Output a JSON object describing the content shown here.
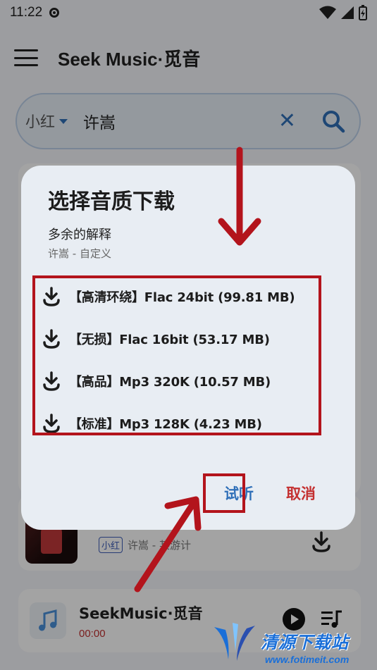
{
  "status_bar": {
    "time": "11:22"
  },
  "app_bar": {
    "title": "Seek Music·觅音"
  },
  "search": {
    "source": "小红",
    "query": "许嵩"
  },
  "background_result": {
    "tag": "小红",
    "meta": "许嵩 - 某游计"
  },
  "player": {
    "title": "SeekMusic·觅音",
    "time": "00:00"
  },
  "dialog": {
    "title": "选择音质下载",
    "song_title": "多余的解释",
    "song_subtitle": "许嵩 - 自定义",
    "qualities": [
      {
        "label": "【高清环绕】Flac 24bit (99.81 MB)"
      },
      {
        "label": "【无损】Flac 16bit (53.17 MB)"
      },
      {
        "label": "【高品】Mp3 320K (10.57 MB)"
      },
      {
        "label": "【标准】Mp3 128K (4.23 MB)"
      }
    ],
    "listen_button": "试听",
    "cancel_button": "取消"
  },
  "watermark": {
    "name": "清源下载站",
    "url": "www.fotimeit.com"
  },
  "colors": {
    "accent": "#2f6fb8",
    "danger": "#c43030",
    "annotation": "#b3141c"
  }
}
